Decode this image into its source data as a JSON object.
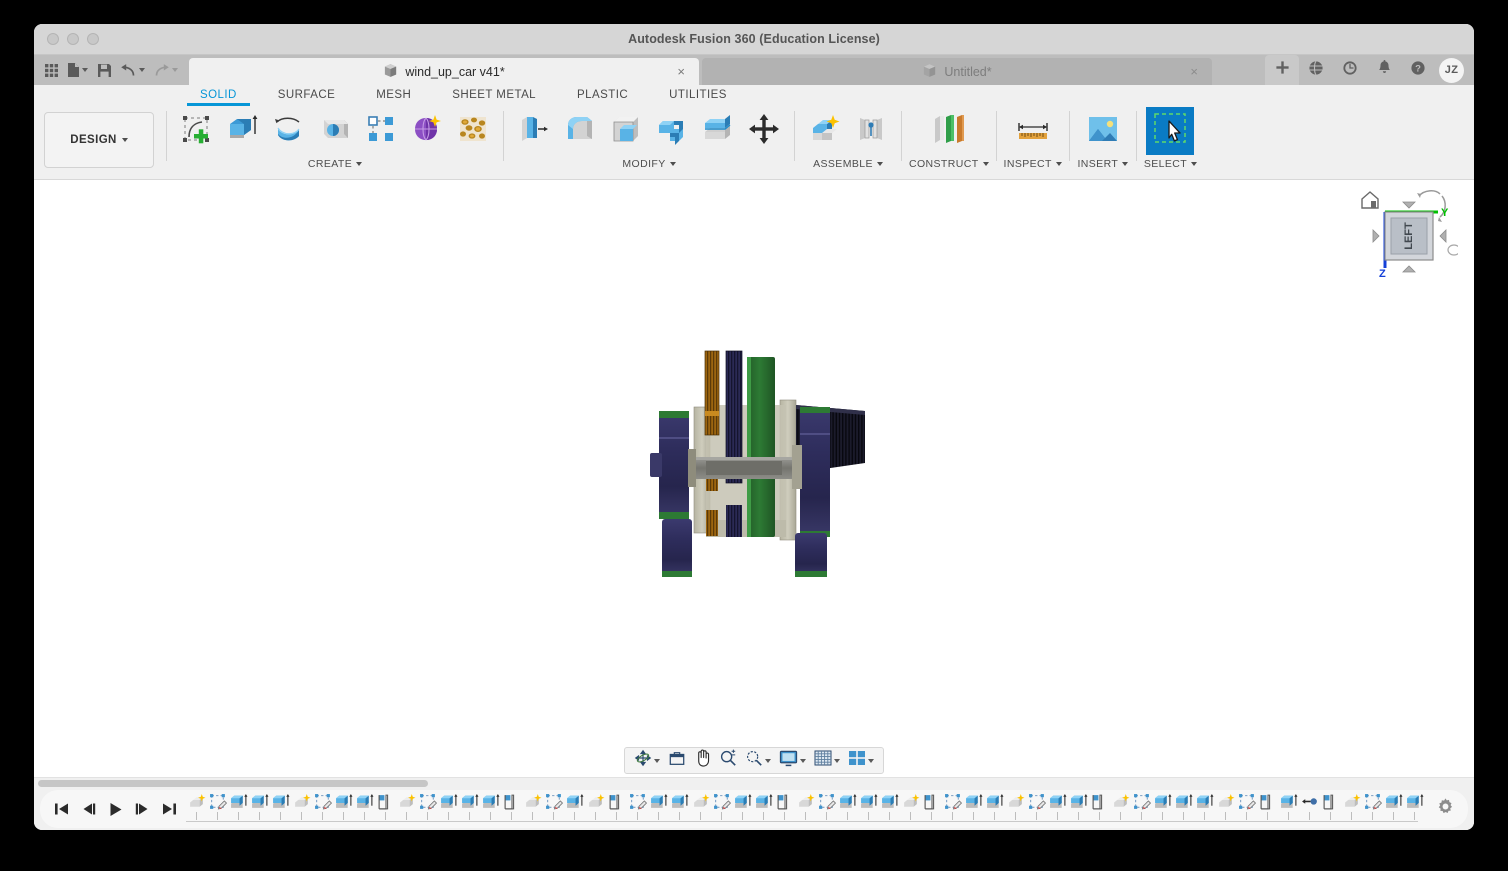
{
  "window": {
    "title": "Autodesk Fusion 360 (Education License)",
    "traffic_lights": [
      "close",
      "minimize",
      "maximize"
    ]
  },
  "quick_access": {
    "items": [
      {
        "name": "app-grid",
        "icon": "grid-icon",
        "label": "Apps"
      },
      {
        "name": "new-file",
        "icon": "file-icon",
        "label": "New",
        "caret": true
      },
      {
        "name": "save",
        "icon": "save-icon",
        "label": "Save"
      },
      {
        "name": "undo",
        "icon": "undo-icon",
        "label": "Undo",
        "caret": true
      },
      {
        "name": "redo",
        "icon": "redo-icon",
        "label": "Redo",
        "caret": true,
        "disabled": true
      }
    ]
  },
  "tabs": [
    {
      "title": "wind_up_car v41*",
      "active": true,
      "close": "×"
    },
    {
      "title": "Untitled*",
      "active": false,
      "close": "×"
    }
  ],
  "system_icons": [
    {
      "name": "add-tab-icon",
      "label": "+"
    },
    {
      "name": "globe-icon",
      "label": "Community"
    },
    {
      "name": "history-icon",
      "label": "Job Status"
    },
    {
      "name": "bell-icon",
      "label": "Notifications"
    },
    {
      "name": "help-icon",
      "label": "Help"
    }
  ],
  "account": {
    "initials": "JZ"
  },
  "workspace": {
    "label": "DESIGN"
  },
  "ribbon": {
    "tabs": [
      {
        "label": "SOLID",
        "active": true
      },
      {
        "label": "SURFACE",
        "active": false
      },
      {
        "label": "MESH",
        "active": false
      },
      {
        "label": "SHEET METAL",
        "active": false
      },
      {
        "label": "PLASTIC",
        "active": false
      },
      {
        "label": "UTILITIES",
        "active": false
      }
    ],
    "groups": [
      {
        "label": "CREATE",
        "has_caret": true,
        "tools": [
          {
            "name": "create-sketch-icon",
            "label": "Create Sketch"
          },
          {
            "name": "extrude-icon",
            "label": "Extrude"
          },
          {
            "name": "revolve-icon",
            "label": "Revolve"
          },
          {
            "name": "sweep-icon",
            "label": "Sweep"
          },
          {
            "name": "pattern-icon",
            "label": "Rectangular Pattern"
          },
          {
            "name": "form-icon",
            "label": "Create Form"
          },
          {
            "name": "generative-design-icon",
            "label": "Generative Design"
          }
        ]
      },
      {
        "label": "MODIFY",
        "has_caret": true,
        "tools": [
          {
            "name": "press-pull-icon",
            "label": "Press Pull"
          },
          {
            "name": "fillet-icon",
            "label": "Fillet"
          },
          {
            "name": "shell-icon",
            "label": "Shell"
          },
          {
            "name": "combine-icon",
            "label": "Combine"
          },
          {
            "name": "offset-face-icon",
            "label": "Offset Face"
          },
          {
            "name": "move-copy-icon",
            "label": "Move/Copy"
          }
        ]
      },
      {
        "label": "ASSEMBLE",
        "has_caret": true,
        "tools": [
          {
            "name": "new-component-icon",
            "label": "New Component"
          },
          {
            "name": "joint-icon",
            "label": "Joint"
          }
        ]
      },
      {
        "label": "CONSTRUCT",
        "has_caret": true,
        "tools": [
          {
            "name": "offset-plane-icon",
            "label": "Offset Plane"
          }
        ]
      },
      {
        "label": "INSPECT",
        "has_caret": true,
        "tools": [
          {
            "name": "measure-icon",
            "label": "Measure"
          }
        ]
      },
      {
        "label": "INSERT",
        "has_caret": true,
        "tools": [
          {
            "name": "insert-image-icon",
            "label": "Decal"
          }
        ]
      },
      {
        "label": "SELECT",
        "has_caret": true,
        "selected": true,
        "tools": [
          {
            "name": "select-tool-icon",
            "label": "Select",
            "active": true
          }
        ]
      }
    ]
  },
  "viewcube": {
    "face": "LEFT",
    "axes": [
      {
        "name": "Y",
        "color": "#00c000"
      },
      {
        "name": "Z",
        "color": "#1540d8"
      }
    ],
    "home_icon": "home-icon",
    "orbit_icon": "orbit-arrows-icon"
  },
  "model": {
    "name": "wind_up_car",
    "colors": {
      "wheel_navy": "#2e2d5c",
      "disc_green": "#2d7a34",
      "gear_bronze": "#9c6510",
      "frame_tan": "#c9c7b6",
      "shaft_gray": "#7d7d7a",
      "spring_black": "#12121c"
    }
  },
  "navigation_bar": {
    "items": [
      {
        "name": "orbit-icon",
        "label": "Orbit",
        "caret": true
      },
      {
        "name": "look-at-icon",
        "label": "Look At",
        "caret": false
      },
      {
        "name": "pan-icon",
        "label": "Pan",
        "caret": false
      },
      {
        "name": "zoom-icon",
        "label": "Zoom",
        "caret": false
      },
      {
        "name": "zoom-window-icon",
        "label": "Fit",
        "caret": true
      },
      {
        "name": "display-settings-icon",
        "label": "Display Settings",
        "caret": true
      },
      {
        "name": "grid-snaps-icon",
        "label": "Grid and Snaps",
        "caret": true
      },
      {
        "name": "viewports-icon",
        "label": "Viewports",
        "caret": true
      }
    ]
  },
  "timeline": {
    "playback": [
      {
        "name": "go-to-beginning-button",
        "label": "Go to Beginning"
      },
      {
        "name": "step-back-button",
        "label": "Step Back"
      },
      {
        "name": "play-button",
        "label": "Play Playback"
      },
      {
        "name": "step-forward-button",
        "label": "Step Forward"
      },
      {
        "name": "go-to-end-button",
        "label": "Go to End"
      }
    ],
    "settings_icon": "timeline-settings-gear-icon",
    "features": [
      "component",
      "sketch",
      "extrude",
      "extrude",
      "extrude",
      "component",
      "sketch",
      "extrude",
      "extrude",
      "plane",
      "component",
      "sketch",
      "extrude",
      "extrude",
      "extrude",
      "plane",
      "component",
      "sketch",
      "extrude",
      "component",
      "plane",
      "sketch",
      "extrude",
      "extrude",
      "component",
      "sketch",
      "extrude",
      "extrude",
      "plane",
      "component",
      "sketch",
      "extrude",
      "extrude",
      "extrude",
      "component",
      "plane",
      "sketch",
      "extrude",
      "extrude",
      "component",
      "sketch",
      "extrude",
      "extrude",
      "plane",
      "component",
      "sketch",
      "extrude",
      "extrude",
      "extrude",
      "component",
      "sketch",
      "plane",
      "extrude",
      "joint",
      "plane",
      "component",
      "sketch",
      "extrude",
      "extrude",
      "extrude",
      "extrude",
      "extrude",
      "component",
      "plane"
    ]
  },
  "scrollbar": {
    "name": "canvas-horizontal-scrollbar"
  }
}
